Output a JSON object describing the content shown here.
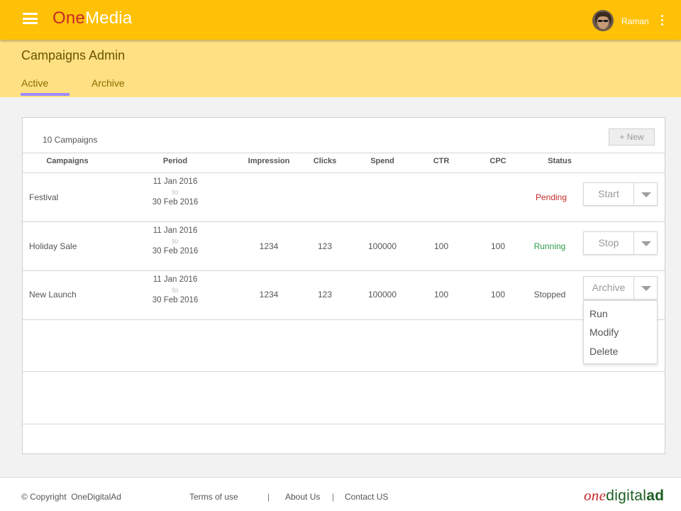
{
  "app": {
    "logo_one": "One",
    "logo_media": "Media",
    "user_name": "Raman"
  },
  "page": {
    "title": "Campaigns Admin",
    "tabs": [
      {
        "label": "Active",
        "selected": true
      },
      {
        "label": "Archive",
        "selected": false
      }
    ]
  },
  "campaigns": {
    "count_label": "10 Campaigns",
    "new_button": "+ New",
    "columns": [
      "Campaigns",
      "Period",
      "Impression",
      "Clicks",
      "Spend",
      "CTR",
      "CPC",
      "Status"
    ],
    "rows": [
      {
        "name": "Festival",
        "period_start": "11 Jan 2016",
        "period_to": "to",
        "period_end": "30 Feb 2016",
        "impression": "",
        "clicks": "",
        "spend": "",
        "ctr": "",
        "cpc": "",
        "status": "Pending",
        "action": "Start"
      },
      {
        "name": "Holiday Sale",
        "period_start": "11 Jan 2016",
        "period_to": "to",
        "period_end": "30 Feb 2016",
        "impression": "1234",
        "clicks": "123",
        "spend": "100000",
        "ctr": "100",
        "cpc": "100",
        "status": "Running",
        "action": "Stop"
      },
      {
        "name": "New Launch",
        "period_start": "11 Jan 2016",
        "period_to": "to",
        "period_end": "30 Feb 2016",
        "impression": "1234",
        "clicks": "123",
        "spend": "100000",
        "ctr": "100",
        "cpc": "100",
        "status": "Stopped",
        "action": "Archive"
      }
    ],
    "action_menu": [
      "Run",
      "Modify",
      "Delete"
    ]
  },
  "footer": {
    "copyright": "© Copyright  OneDigitalAd",
    "links": [
      "Terms of use",
      "About Us",
      "Contact US"
    ],
    "separator": "|",
    "brand_one": "one",
    "brand_digital": "digital",
    "brand_ad": "ad"
  },
  "colors": {
    "topbar": "#ffc107",
    "subheader": "#ffe082",
    "tab_indicator": "#9b8cff",
    "pending": "#c62828",
    "running": "#2e9e4f"
  }
}
